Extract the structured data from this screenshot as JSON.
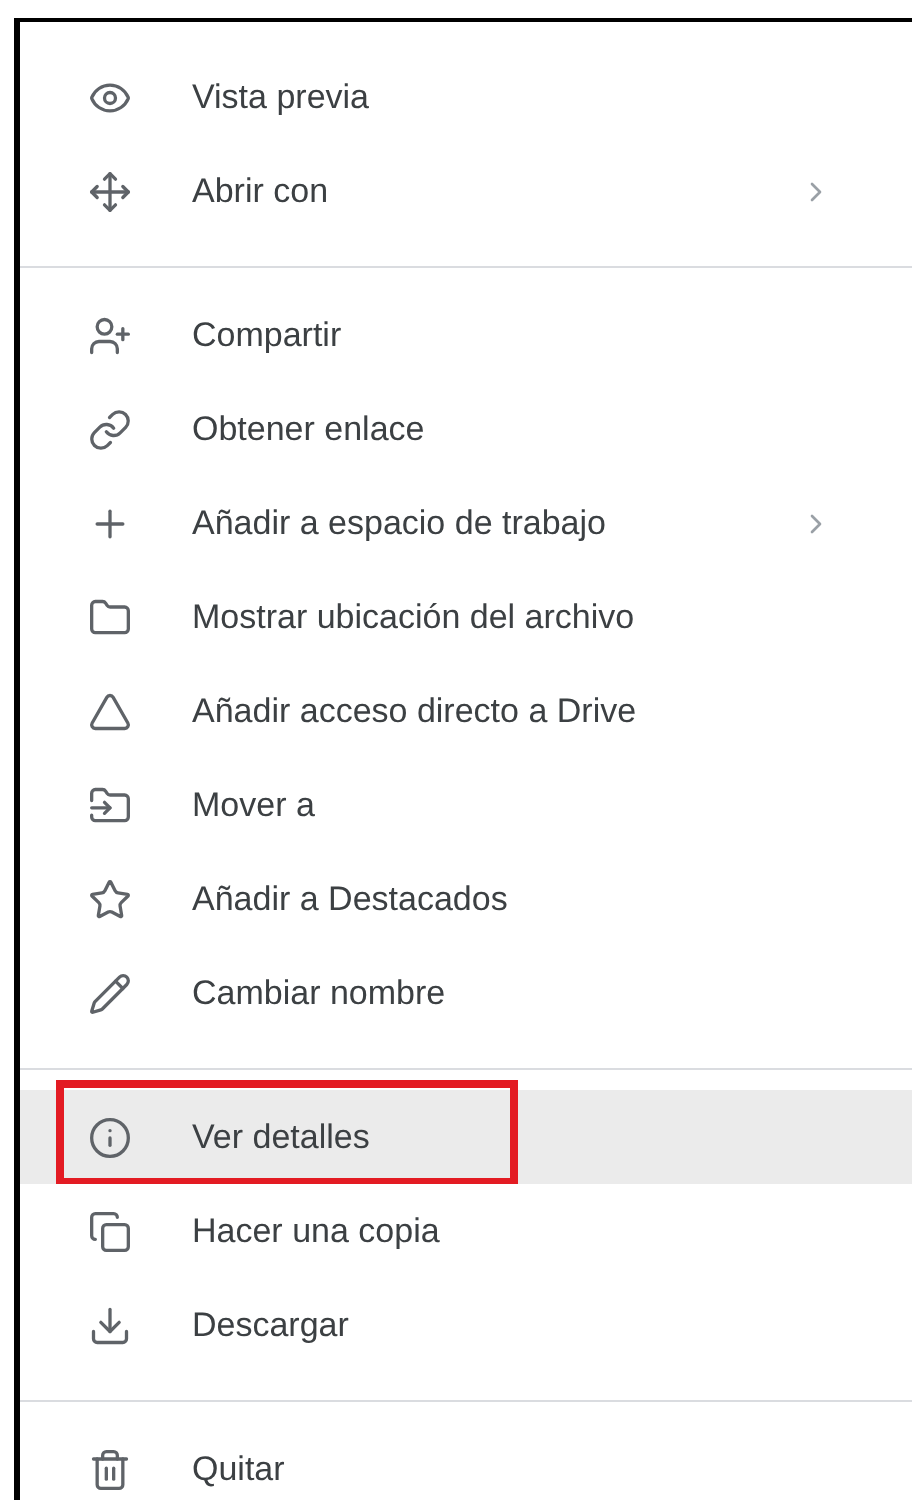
{
  "menu": {
    "groups": [
      {
        "items": [
          {
            "label": "Vista previa",
            "submenu": false,
            "selected": false,
            "marked": false
          },
          {
            "label": "Abrir con",
            "submenu": true,
            "selected": false,
            "marked": false
          }
        ]
      },
      {
        "items": [
          {
            "label": "Compartir",
            "submenu": false,
            "selected": false,
            "marked": false
          },
          {
            "label": "Obtener enlace",
            "submenu": false,
            "selected": false,
            "marked": false
          },
          {
            "label": "Añadir a espacio de trabajo",
            "submenu": true,
            "selected": false,
            "marked": false
          },
          {
            "label": "Mostrar ubicación del archivo",
            "submenu": false,
            "selected": false,
            "marked": false
          },
          {
            "label": "Añadir acceso directo a Drive",
            "submenu": false,
            "selected": false,
            "marked": false
          },
          {
            "label": "Mover a",
            "submenu": false,
            "selected": false,
            "marked": false
          },
          {
            "label": "Añadir a Destacados",
            "submenu": false,
            "selected": false,
            "marked": false
          },
          {
            "label": "Cambiar nombre",
            "submenu": false,
            "selected": false,
            "marked": false
          }
        ]
      },
      {
        "items": [
          {
            "label": "Ver detalles",
            "submenu": false,
            "selected": true,
            "marked": true
          },
          {
            "label": "Hacer una copia",
            "submenu": false,
            "selected": false,
            "marked": false
          },
          {
            "label": "Descargar",
            "submenu": false,
            "selected": false,
            "marked": false
          }
        ]
      },
      {
        "items": [
          {
            "label": "Quitar",
            "submenu": false,
            "selected": false,
            "marked": false
          }
        ]
      }
    ]
  }
}
